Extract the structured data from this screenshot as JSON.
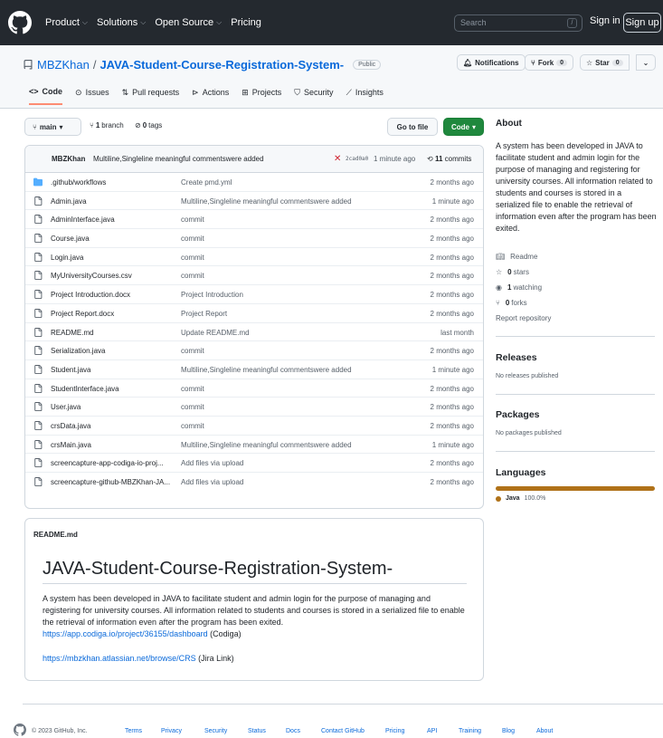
{
  "header": {
    "nav": [
      {
        "label": "Product",
        "chevron": true
      },
      {
        "label": "Solutions",
        "chevron": true
      },
      {
        "label": "Open Source",
        "chevron": true
      },
      {
        "label": "Pricing",
        "chevron": false
      }
    ],
    "search_placeholder": "Search",
    "search_shortcut": "/",
    "sign_in": "Sign in",
    "sign_up": "Sign up"
  },
  "repo": {
    "owner": "MBZKhan",
    "separator": "/",
    "name": "JAVA-Student-Course-Registration-System-",
    "visibility": "Public",
    "notifications_label": "Notifications",
    "fork_label": "Fork",
    "fork_count": "0",
    "star_label": "Star",
    "star_count": "0",
    "tabs": [
      {
        "label": "Code",
        "active": true,
        "icon": "code-icon"
      },
      {
        "label": "Issues",
        "active": false,
        "icon": "issue-icon"
      },
      {
        "label": "Pull requests",
        "active": false,
        "icon": "pull-request-icon"
      },
      {
        "label": "Actions",
        "active": false,
        "icon": "play-icon"
      },
      {
        "label": "Projects",
        "active": false,
        "icon": "table-icon"
      },
      {
        "label": "Security",
        "active": false,
        "icon": "shield-icon"
      },
      {
        "label": "Insights",
        "active": false,
        "icon": "graph-icon"
      }
    ]
  },
  "branchbar": {
    "branch": "main",
    "branch_count": "1",
    "branch_word": "branch",
    "tag_count": "0",
    "tag_word": "tags",
    "go_to_file": "Go to file",
    "code_button": "Code"
  },
  "latest_commit": {
    "author": "MBZKhan",
    "message": "Multiline,Singleline meaningful commentswere added",
    "status": "✕",
    "sha": "2cad0a0",
    "time": "1 minute ago",
    "commit_count": "11",
    "commit_word": "commits"
  },
  "files": [
    {
      "name": ".github/workflows",
      "message": "Create pmd.yml",
      "age": "2 months ago",
      "type": "folder"
    },
    {
      "name": "Admin.java",
      "message": "Multiline,Singleline meaningful commentswere added",
      "age": "1 minute ago",
      "type": "file"
    },
    {
      "name": "AdminInterface.java",
      "message": "commit",
      "age": "2 months ago",
      "type": "file"
    },
    {
      "name": "Course.java",
      "message": "commit",
      "age": "2 months ago",
      "type": "file"
    },
    {
      "name": "Login.java",
      "message": "commit",
      "age": "2 months ago",
      "type": "file"
    },
    {
      "name": "MyUniversityCourses.csv",
      "message": "commit",
      "age": "2 months ago",
      "type": "file"
    },
    {
      "name": "Project Introduction.docx",
      "message": "Project Introduction",
      "age": "2 months ago",
      "type": "file"
    },
    {
      "name": "Project Report.docx",
      "message": "Project Report",
      "age": "2 months ago",
      "type": "file"
    },
    {
      "name": "README.md",
      "message": "Update README.md",
      "age": "last month",
      "type": "file"
    },
    {
      "name": "Serialization.java",
      "message": "commit",
      "age": "2 months ago",
      "type": "file"
    },
    {
      "name": "Student.java",
      "message": "Multiline,Singleline meaningful commentswere added",
      "age": "1 minute ago",
      "type": "file"
    },
    {
      "name": "StudentInterface.java",
      "message": "commit",
      "age": "2 months ago",
      "type": "file"
    },
    {
      "name": "User.java",
      "message": "commit",
      "age": "2 months ago",
      "type": "file"
    },
    {
      "name": "crsData.java",
      "message": "commit",
      "age": "2 months ago",
      "type": "file"
    },
    {
      "name": "crsMain.java",
      "message": "Multiline,Singleline meaningful commentswere added",
      "age": "1 minute ago",
      "type": "file"
    },
    {
      "name": "screencapture-app-codiga-io-proj...",
      "message": "Add files via upload",
      "age": "2 months ago",
      "type": "file"
    },
    {
      "name": "screencapture-github-MBZKhan-JA...",
      "message": "Add files via upload",
      "age": "2 months ago",
      "type": "file"
    }
  ],
  "readme": {
    "header": "README.md",
    "title": "JAVA-Student-Course-Registration-System-",
    "paragraph": "A system has been developed in JAVA to facilitate student and admin login for the purpose of managing and registering for university courses. All information related to students and courses is stored in a serialized file to enable the retrieval of information even after the program has been exited.",
    "link1": "https://app.codiga.io/project/36155/dashboard",
    "link1_suffix": " (Codiga)",
    "link2": "https://mbzkhan.atlassian.net/browse/CRS",
    "link2_suffix": " (Jira Link)"
  },
  "sidebar": {
    "about_title": "About",
    "about_text": "A system has been developed in JAVA to facilitate student and admin login for the purpose of managing and registering for university courses. All information related to students and courses is stored in a serialized file to enable the retrieval of information even after the program has been exited.",
    "readme": "Readme",
    "stars_count": "0",
    "stars_word": "stars",
    "watching_count": "1",
    "watching_word": "watching",
    "forks_count": "0",
    "forks_word": "forks",
    "report": "Report repository",
    "releases_title": "Releases",
    "releases_text": "No releases published",
    "packages_title": "Packages",
    "packages_text": "No packages published",
    "languages_title": "Languages",
    "language_name": "Java",
    "language_pct": "100.0%",
    "language_color": "#b07219"
  },
  "footer": {
    "copyright": "© 2023 GitHub, Inc.",
    "links": [
      "Terms",
      "Privacy",
      "Security",
      "Status",
      "Docs",
      "Contact GitHub",
      "Pricing",
      "API",
      "Training",
      "Blog",
      "About"
    ]
  }
}
